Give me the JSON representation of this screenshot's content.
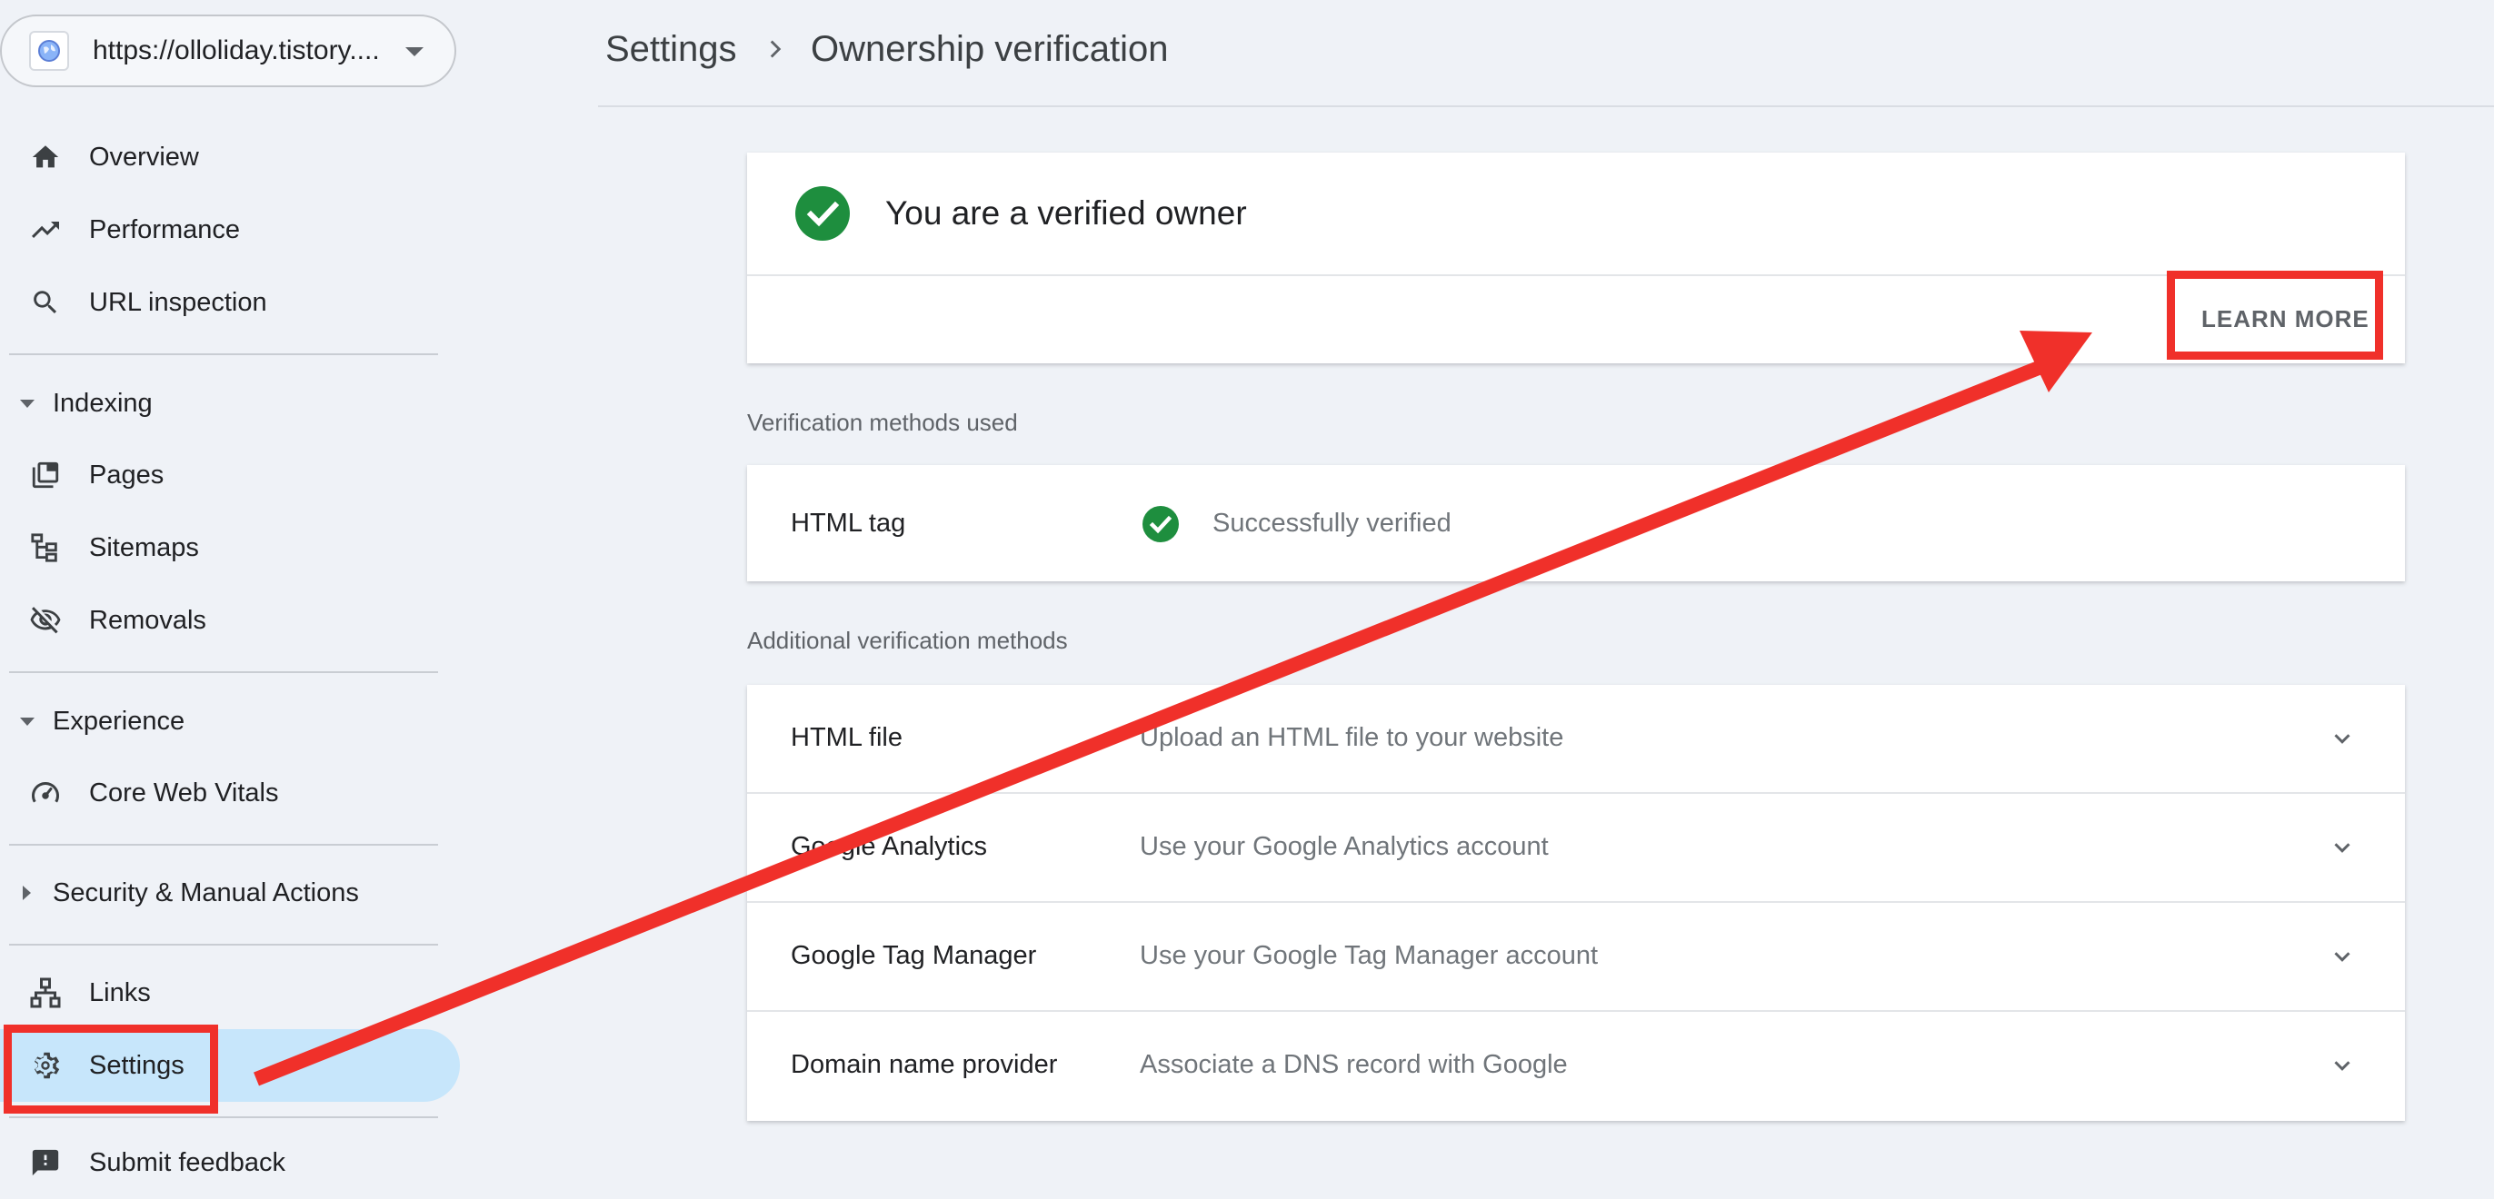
{
  "property": {
    "url": "https://olloliday.tistory...."
  },
  "sidebar": {
    "items_top": [
      {
        "label": "Overview",
        "icon": "home-icon"
      },
      {
        "label": "Performance",
        "icon": "trending-up-icon"
      },
      {
        "label": "URL inspection",
        "icon": "search-icon"
      }
    ],
    "indexing": {
      "header": "Indexing",
      "items": [
        {
          "label": "Pages",
          "icon": "pages-icon"
        },
        {
          "label": "Sitemaps",
          "icon": "sitemap-icon"
        },
        {
          "label": "Removals",
          "icon": "eye-off-icon"
        }
      ]
    },
    "experience": {
      "header": "Experience",
      "items": [
        {
          "label": "Core Web Vitals",
          "icon": "gauge-icon"
        }
      ]
    },
    "security": {
      "header": "Security & Manual Actions"
    },
    "links": {
      "label": "Links",
      "icon": "links-icon"
    },
    "settings": {
      "label": "Settings",
      "icon": "gear-icon"
    },
    "feedback": {
      "label": "Submit feedback",
      "icon": "feedback-icon"
    }
  },
  "breadcrumb": {
    "root": "Settings",
    "current": "Ownership verification"
  },
  "owner_card": {
    "title": "You are a verified owner",
    "learn_more": "LEARN MORE"
  },
  "methods_used": {
    "caption": "Verification methods used",
    "rows": [
      {
        "name": "HTML tag",
        "status": "Successfully verified"
      }
    ]
  },
  "additional_methods": {
    "caption": "Additional verification methods",
    "rows": [
      {
        "name": "HTML file",
        "desc": "Upload an HTML file to your website"
      },
      {
        "name": "Google Analytics",
        "desc": "Use your Google Analytics account"
      },
      {
        "name": "Google Tag Manager",
        "desc": "Use your Google Tag Manager account"
      },
      {
        "name": "Domain name provider",
        "desc": "Associate a DNS record with Google"
      }
    ]
  },
  "colors": {
    "verified_green": "#1e8e3e",
    "annotation_red": "#f0302a",
    "active_nav_bg": "#c7e6fb",
    "page_bg": "#eff2f7"
  }
}
